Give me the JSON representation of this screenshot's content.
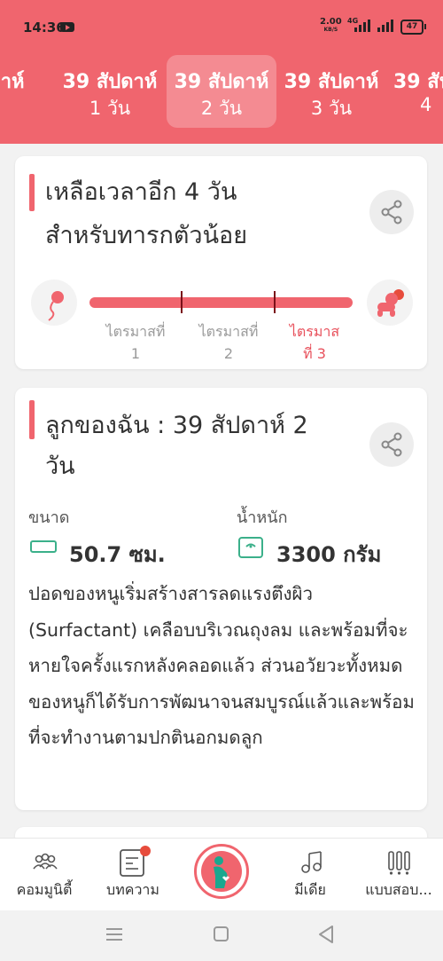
{
  "status_bar": {
    "time": "14:36",
    "speed": "2.00",
    "speed_unit": "KB/S",
    "network": "4G",
    "battery": "47"
  },
  "week_tabs": [
    {
      "line1": "ปดาห์",
      "line2": ""
    },
    {
      "line1": "39 สัปดาห์",
      "line2": "1 วัน"
    },
    {
      "line1": "39 สัปดาห์",
      "line2": "2 วัน",
      "active": true
    },
    {
      "line1": "39 สัปดาห์",
      "line2": "3 วัน"
    },
    {
      "line1": "39 สัป",
      "line2": "4"
    }
  ],
  "countdown_card": {
    "title_line1": "เหลือเวลาอีก 4 วัน",
    "title_line2": "สำหรับทารกตัวน้อย",
    "progress_fraction": 0.98,
    "trimesters": [
      {
        "line1": "ไตรมาสที่",
        "line2": "1"
      },
      {
        "line1": "ไตรมาสที่",
        "line2": "2"
      },
      {
        "line1": "ไตรมาส",
        "line2": "ที่ 3"
      }
    ]
  },
  "baby_card": {
    "title_line1": "ลูกของฉัน : 39 สัปดาห์ 2",
    "title_line2": "วัน",
    "size_label": "ขนาด",
    "size_value": "50.7 ซม.",
    "weight_label": "น้ำหนัก",
    "weight_value": "3300 กรัม",
    "description": "ปอดของหนูเริ่มสร้างสารลดแรงตึงผิว (Surfactant) เคลือบบริเวณถุงลม และพร้อมที่จะหายใจครั้งแรกหลังคลอดแล้ว ส่วนอวัยวะทั้งหมดของหนูก็ได้รับการพัฒนาจนสมบูรณ์แล้วและพร้อมที่จะทำงานตามปกตินอกมดลูก"
  },
  "tabbar": {
    "community": "คอมมูนิตี้",
    "articles": "บทความ",
    "media": "มีเดีย",
    "quiz": "แบบสอบ..."
  },
  "colors": {
    "brand": "#f0656e",
    "accent_green": "#3bb08a"
  }
}
